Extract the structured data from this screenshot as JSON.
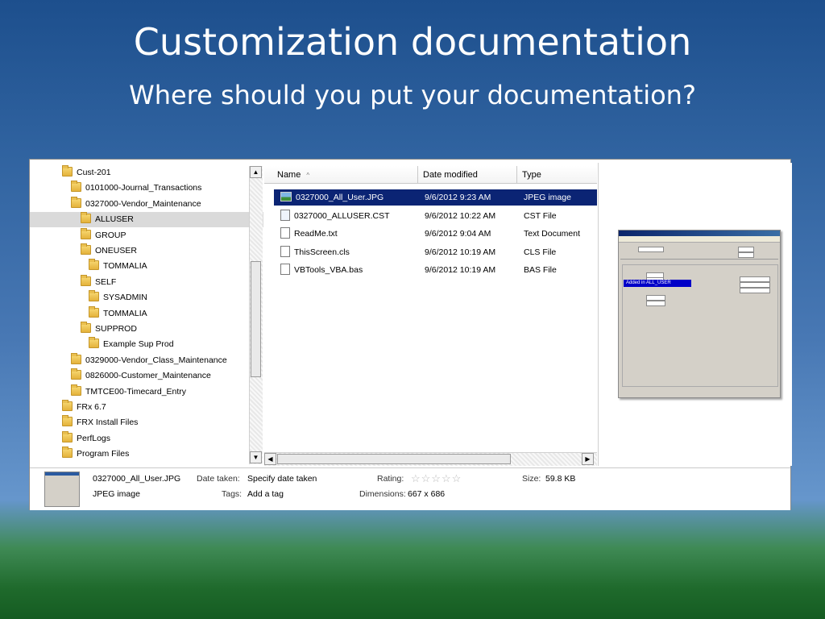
{
  "slide": {
    "title": "Customization documentation",
    "subtitle": "Where should you put your documentation?"
  },
  "tree": {
    "selected_index": 3,
    "items": [
      {
        "label": "Cust-201",
        "level": 0
      },
      {
        "label": "0101000-Journal_Transactions",
        "level": 1
      },
      {
        "label": "0327000-Vendor_Maintenance",
        "level": 1
      },
      {
        "label": "ALLUSER",
        "level": 2
      },
      {
        "label": "GROUP",
        "level": 2
      },
      {
        "label": "ONEUSER",
        "level": 2
      },
      {
        "label": "TOMMALIA",
        "level": 3
      },
      {
        "label": "SELF",
        "level": 2
      },
      {
        "label": "SYSADMIN",
        "level": 3
      },
      {
        "label": "TOMMALIA",
        "level": 3
      },
      {
        "label": "SUPPROD",
        "level": 2
      },
      {
        "label": "Example Sup Prod",
        "level": 3
      },
      {
        "label": "0329000-Vendor_Class_Maintenance",
        "level": 1
      },
      {
        "label": "0826000-Customer_Maintenance",
        "level": 1
      },
      {
        "label": "TMTCE00-Timecard_Entry",
        "level": 1
      },
      {
        "label": "FRx 6.7",
        "level": 0
      },
      {
        "label": "FRX Install Files",
        "level": 0
      },
      {
        "label": "PerfLogs",
        "level": 0
      },
      {
        "label": "Program Files",
        "level": 0
      }
    ]
  },
  "file_list": {
    "columns": {
      "name": "Name",
      "sort_indicator": "^",
      "date": "Date modified",
      "type": "Type"
    },
    "selected_index": 0,
    "rows": [
      {
        "name": "0327000_All_User.JPG",
        "date": "9/6/2012 9:23 AM",
        "type": "JPEG image",
        "icon": "jpg"
      },
      {
        "name": "0327000_ALLUSER.CST",
        "date": "9/6/2012 10:22 AM",
        "type": "CST File",
        "icon": "cst"
      },
      {
        "name": "ReadMe.txt",
        "date": "9/6/2012 9:04 AM",
        "type": "Text Document",
        "icon": "txt"
      },
      {
        "name": "ThisScreen.cls",
        "date": "9/6/2012 10:19 AM",
        "type": "CLS File",
        "icon": "file"
      },
      {
        "name": "VBTools_VBA.bas",
        "date": "9/6/2012 10:19 AM",
        "type": "BAS File",
        "icon": "file"
      }
    ]
  },
  "preview": {
    "banner": "Added in ALL_USER"
  },
  "details": {
    "file_name": "0327000_All_User.JPG",
    "file_type": "JPEG image",
    "date_taken_label": "Date taken:",
    "date_taken_value": "Specify date taken",
    "tags_label": "Tags:",
    "tags_value": "Add a tag",
    "rating_label": "Rating:",
    "rating_stars": "☆☆☆☆☆",
    "dimensions_label": "Dimensions:",
    "dimensions_value": "667 x 686",
    "size_label": "Size:",
    "size_value": "59.8 KB"
  }
}
